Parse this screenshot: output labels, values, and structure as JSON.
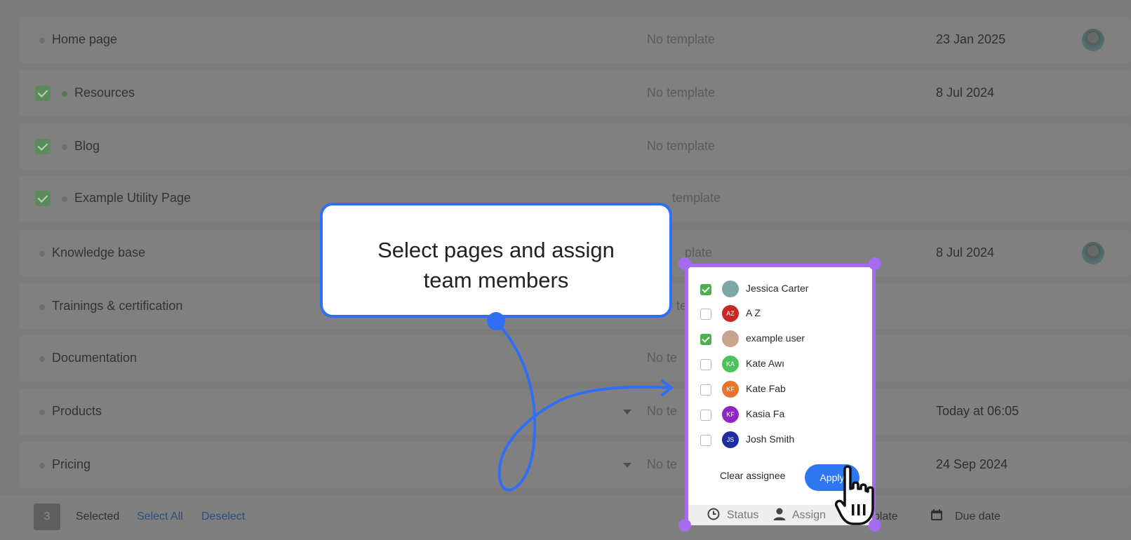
{
  "rows": [
    {
      "name": "Home page",
      "template": "No template",
      "date": "23 Jan 2025",
      "checked": false
    },
    {
      "name": "Resources",
      "template": "No template",
      "date": "8 Jul 2024",
      "checked": true
    },
    {
      "name": "Blog",
      "template": "No template",
      "date": "",
      "checked": true
    },
    {
      "name": "Example Utility Page",
      "template": "template",
      "date": "",
      "checked": true
    },
    {
      "name": "Knowledge base",
      "template": "plate",
      "date": "8 Jul 2024",
      "checked": false
    },
    {
      "name": "Trainings & certification",
      "template": "te",
      "date": "",
      "checked": false
    },
    {
      "name": "Documentation",
      "template": "No te",
      "date": "",
      "checked": false
    },
    {
      "name": "Products",
      "template": "No te",
      "date": "Today at 06:05",
      "checked": false
    },
    {
      "name": "Pricing",
      "template": "No te",
      "date": "24 Sep 2024",
      "checked": false
    }
  ],
  "callout": {
    "line1": "Select pages and assign",
    "line2": "team members"
  },
  "assignees": [
    {
      "name": "Jessica Carter",
      "initials": "",
      "color": "#7aa8a6",
      "checked": true
    },
    {
      "name": "A Z",
      "initials": "AZ",
      "color": "#c62828",
      "checked": false
    },
    {
      "name": "example user",
      "initials": "",
      "color": "#c9a38d",
      "checked": true
    },
    {
      "name": "Kate Awı",
      "initials": "KA",
      "color": "#4bc25a",
      "checked": false
    },
    {
      "name": "Kate Fab",
      "initials": "KF",
      "color": "#e8742b",
      "checked": false
    },
    {
      "name": "Kasia Fa",
      "initials": "KF",
      "color": "#9124c9",
      "checked": false
    },
    {
      "name": "Josh Smith",
      "initials": "JS",
      "color": "#1f2e9e",
      "checked": false
    }
  ],
  "dropdown": {
    "clear_label": "Clear assignee",
    "apply_label": "Apply"
  },
  "bottom_bar": {
    "count": "3",
    "selected_label": "Selected",
    "select_all_label": "Select All",
    "deselect_label": "Deselect",
    "status_label": "Status",
    "assign_label": "Assign",
    "template_label": "plate",
    "due_date_label": "Due date"
  },
  "colors": {
    "callout_border": "#2f6ef5",
    "dropdown_border": "#a66bf0",
    "apply_button": "#2f77f2"
  }
}
